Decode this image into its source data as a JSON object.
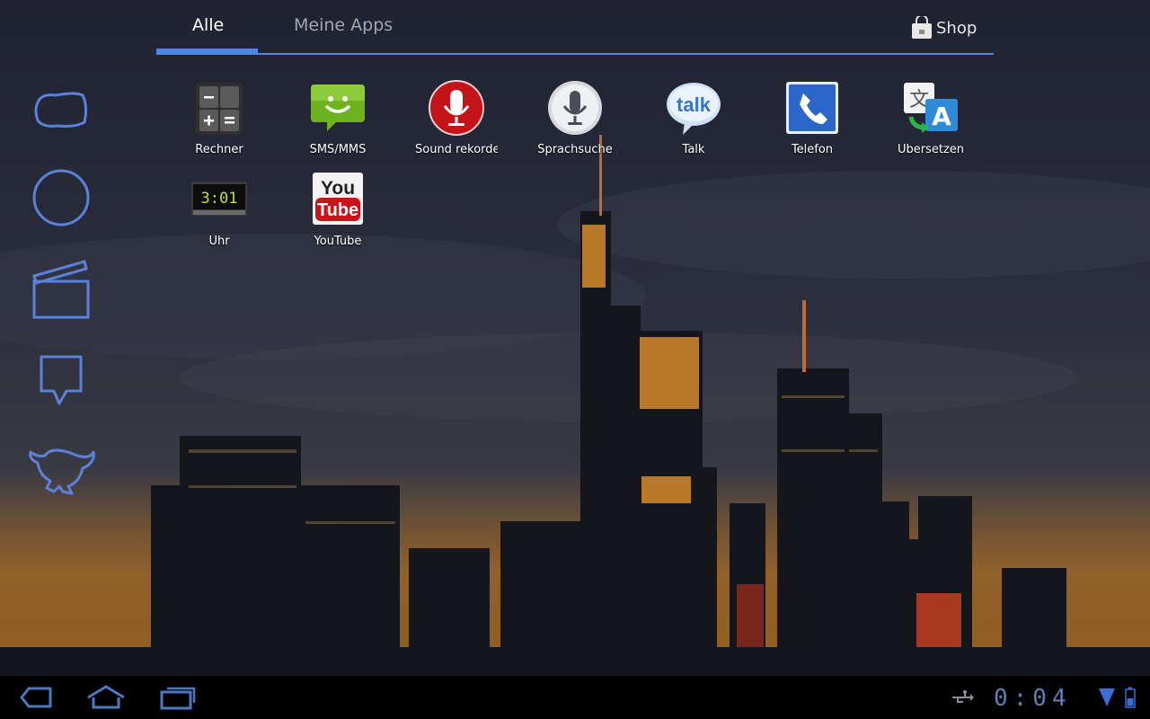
{
  "tabs": {
    "all": "Alle",
    "my_apps": "Meine Apps",
    "shop": "Shop"
  },
  "apps": [
    {
      "label": "Rechner",
      "icon": "calculator-icon"
    },
    {
      "label": "SMS/MMS",
      "icon": "messaging-icon"
    },
    {
      "label": "Sound rekorde",
      "icon": "sound-recorder-icon"
    },
    {
      "label": "Sprachsuche",
      "icon": "voice-search-icon"
    },
    {
      "label": "Talk",
      "icon": "talk-icon"
    },
    {
      "label": "Telefon",
      "icon": "phone-icon"
    },
    {
      "label": "Übersetzen",
      "icon": "translate-icon"
    },
    {
      "label": "Uhr",
      "icon": "clock-icon",
      "display": "3:01"
    },
    {
      "label": "YouTube",
      "icon": "youtube-icon",
      "logo_you": "You",
      "logo_tube": "Tube"
    }
  ],
  "talk_logo": "talk",
  "status": {
    "time": "0:04"
  },
  "colors": {
    "accent": "#4d86e6",
    "neon": "#5b82d8",
    "clock": "#5f7fb6"
  }
}
